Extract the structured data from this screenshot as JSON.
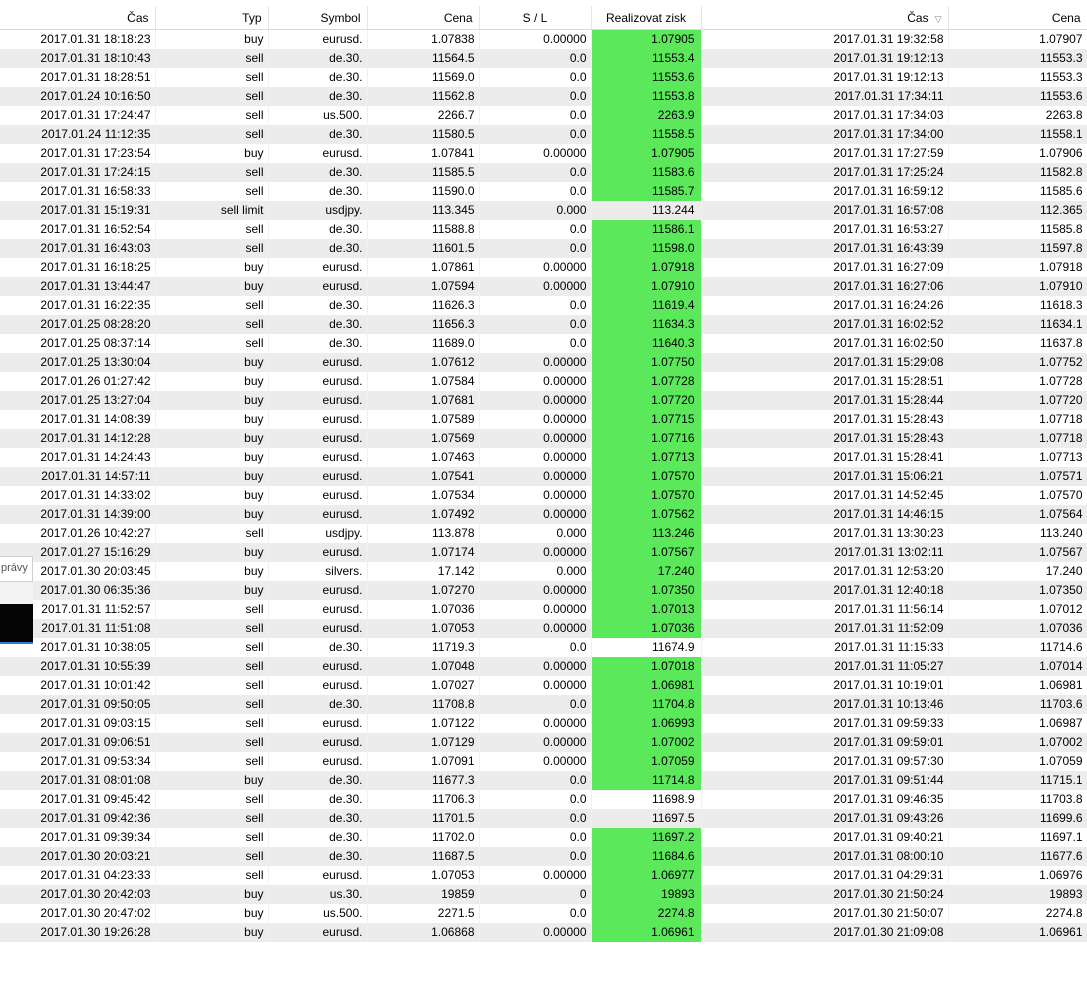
{
  "columns": [
    {
      "key": "open_time",
      "label": "Čas",
      "width": 155
    },
    {
      "key": "type",
      "label": "Typ",
      "width": 113
    },
    {
      "key": "symbol",
      "label": "Symbol",
      "width": 99
    },
    {
      "key": "open_price",
      "label": "Cena",
      "width": 112
    },
    {
      "key": "sl",
      "label": "S / L",
      "width": 112
    },
    {
      "key": "tp",
      "label": "Realizovat zisk",
      "width": 110
    },
    {
      "key": "close_time",
      "label": "Čas",
      "width": 247,
      "sort_indicator": "▽"
    },
    {
      "key": "close_price",
      "label": "Cena",
      "width": 139
    }
  ],
  "colors": {
    "tp_hit": "#5be85b",
    "row_alt": "#ececec",
    "row": "#ffffff"
  },
  "background_window": {
    "label": "právy"
  },
  "rows": [
    {
      "open_time": "2017.01.31 18:18:23",
      "type": "buy",
      "symbol": "eurusd.",
      "open_price": "1.07838",
      "sl": "0.00000",
      "tp": "1.07905",
      "close_time": "2017.01.31 19:32:58",
      "close_price": "1.07907",
      "tp_hit": true
    },
    {
      "open_time": "2017.01.31 18:10:43",
      "type": "sell",
      "symbol": "de.30.",
      "open_price": "11564.5",
      "sl": "0.0",
      "tp": "11553.4",
      "close_time": "2017.01.31 19:12:13",
      "close_price": "11553.3",
      "tp_hit": true
    },
    {
      "open_time": "2017.01.31 18:28:51",
      "type": "sell",
      "symbol": "de.30.",
      "open_price": "11569.0",
      "sl": "0.0",
      "tp": "11553.6",
      "close_time": "2017.01.31 19:12:13",
      "close_price": "11553.3",
      "tp_hit": true
    },
    {
      "open_time": "2017.01.24 10:16:50",
      "type": "sell",
      "symbol": "de.30.",
      "open_price": "11562.8",
      "sl": "0.0",
      "tp": "11553.8",
      "close_time": "2017.01.31 17:34:11",
      "close_price": "11553.6",
      "tp_hit": true
    },
    {
      "open_time": "2017.01.31 17:24:47",
      "type": "sell",
      "symbol": "us.500.",
      "open_price": "2266.7",
      "sl": "0.0",
      "tp": "2263.9",
      "close_time": "2017.01.31 17:34:03",
      "close_price": "2263.8",
      "tp_hit": true
    },
    {
      "open_time": "2017.01.24 11:12:35",
      "type": "sell",
      "symbol": "de.30.",
      "open_price": "11580.5",
      "sl": "0.0",
      "tp": "11558.5",
      "close_time": "2017.01.31 17:34:00",
      "close_price": "11558.1",
      "tp_hit": true
    },
    {
      "open_time": "2017.01.31 17:23:54",
      "type": "buy",
      "symbol": "eurusd.",
      "open_price": "1.07841",
      "sl": "0.00000",
      "tp": "1.07905",
      "close_time": "2017.01.31 17:27:59",
      "close_price": "1.07906",
      "tp_hit": true
    },
    {
      "open_time": "2017.01.31 17:24:15",
      "type": "sell",
      "symbol": "de.30.",
      "open_price": "11585.5",
      "sl": "0.0",
      "tp": "11583.6",
      "close_time": "2017.01.31 17:25:24",
      "close_price": "11582.8",
      "tp_hit": true
    },
    {
      "open_time": "2017.01.31 16:58:33",
      "type": "sell",
      "symbol": "de.30.",
      "open_price": "11590.0",
      "sl": "0.0",
      "tp": "11585.7",
      "close_time": "2017.01.31 16:59:12",
      "close_price": "11585.6",
      "tp_hit": true
    },
    {
      "open_time": "2017.01.31 15:19:31",
      "type": "sell limit",
      "symbol": "usdjpy.",
      "open_price": "113.345",
      "sl": "0.000",
      "tp": "113.244",
      "close_time": "2017.01.31 16:57:08",
      "close_price": "112.365",
      "tp_hit": false
    },
    {
      "open_time": "2017.01.31 16:52:54",
      "type": "sell",
      "symbol": "de.30.",
      "open_price": "11588.8",
      "sl": "0.0",
      "tp": "11586.1",
      "close_time": "2017.01.31 16:53:27",
      "close_price": "11585.8",
      "tp_hit": true
    },
    {
      "open_time": "2017.01.31 16:43:03",
      "type": "sell",
      "symbol": "de.30.",
      "open_price": "11601.5",
      "sl": "0.0",
      "tp": "11598.0",
      "close_time": "2017.01.31 16:43:39",
      "close_price": "11597.8",
      "tp_hit": true
    },
    {
      "open_time": "2017.01.31 16:18:25",
      "type": "buy",
      "symbol": "eurusd.",
      "open_price": "1.07861",
      "sl": "0.00000",
      "tp": "1.07918",
      "close_time": "2017.01.31 16:27:09",
      "close_price": "1.07918",
      "tp_hit": true
    },
    {
      "open_time": "2017.01.31 13:44:47",
      "type": "buy",
      "symbol": "eurusd.",
      "open_price": "1.07594",
      "sl": "0.00000",
      "tp": "1.07910",
      "close_time": "2017.01.31 16:27:06",
      "close_price": "1.07910",
      "tp_hit": true
    },
    {
      "open_time": "2017.01.31 16:22:35",
      "type": "sell",
      "symbol": "de.30.",
      "open_price": "11626.3",
      "sl": "0.0",
      "tp": "11619.4",
      "close_time": "2017.01.31 16:24:26",
      "close_price": "11618.3",
      "tp_hit": true
    },
    {
      "open_time": "2017.01.25 08:28:20",
      "type": "sell",
      "symbol": "de.30.",
      "open_price": "11656.3",
      "sl": "0.0",
      "tp": "11634.3",
      "close_time": "2017.01.31 16:02:52",
      "close_price": "11634.1",
      "tp_hit": true
    },
    {
      "open_time": "2017.01.25 08:37:14",
      "type": "sell",
      "symbol": "de.30.",
      "open_price": "11689.0",
      "sl": "0.0",
      "tp": "11640.3",
      "close_time": "2017.01.31 16:02:50",
      "close_price": "11637.8",
      "tp_hit": true
    },
    {
      "open_time": "2017.01.25 13:30:04",
      "type": "buy",
      "symbol": "eurusd.",
      "open_price": "1.07612",
      "sl": "0.00000",
      "tp": "1.07750",
      "close_time": "2017.01.31 15:29:08",
      "close_price": "1.07752",
      "tp_hit": true
    },
    {
      "open_time": "2017.01.26 01:27:42",
      "type": "buy",
      "symbol": "eurusd.",
      "open_price": "1.07584",
      "sl": "0.00000",
      "tp": "1.07728",
      "close_time": "2017.01.31 15:28:51",
      "close_price": "1.07728",
      "tp_hit": true
    },
    {
      "open_time": "2017.01.25 13:27:04",
      "type": "buy",
      "symbol": "eurusd.",
      "open_price": "1.07681",
      "sl": "0.00000",
      "tp": "1.07720",
      "close_time": "2017.01.31 15:28:44",
      "close_price": "1.07720",
      "tp_hit": true
    },
    {
      "open_time": "2017.01.31 14:08:39",
      "type": "buy",
      "symbol": "eurusd.",
      "open_price": "1.07589",
      "sl": "0.00000",
      "tp": "1.07715",
      "close_time": "2017.01.31 15:28:43",
      "close_price": "1.07718",
      "tp_hit": true
    },
    {
      "open_time": "2017.01.31 14:12:28",
      "type": "buy",
      "symbol": "eurusd.",
      "open_price": "1.07569",
      "sl": "0.00000",
      "tp": "1.07716",
      "close_time": "2017.01.31 15:28:43",
      "close_price": "1.07718",
      "tp_hit": true
    },
    {
      "open_time": "2017.01.31 14:24:43",
      "type": "buy",
      "symbol": "eurusd.",
      "open_price": "1.07463",
      "sl": "0.00000",
      "tp": "1.07713",
      "close_time": "2017.01.31 15:28:41",
      "close_price": "1.07713",
      "tp_hit": true
    },
    {
      "open_time": "2017.01.31 14:57:11",
      "type": "buy",
      "symbol": "eurusd.",
      "open_price": "1.07541",
      "sl": "0.00000",
      "tp": "1.07570",
      "close_time": "2017.01.31 15:06:21",
      "close_price": "1.07571",
      "tp_hit": true
    },
    {
      "open_time": "2017.01.31 14:33:02",
      "type": "buy",
      "symbol": "eurusd.",
      "open_price": "1.07534",
      "sl": "0.00000",
      "tp": "1.07570",
      "close_time": "2017.01.31 14:52:45",
      "close_price": "1.07570",
      "tp_hit": true
    },
    {
      "open_time": "2017.01.31 14:39:00",
      "type": "buy",
      "symbol": "eurusd.",
      "open_price": "1.07492",
      "sl": "0.00000",
      "tp": "1.07562",
      "close_time": "2017.01.31 14:46:15",
      "close_price": "1.07564",
      "tp_hit": true
    },
    {
      "open_time": "2017.01.26 10:42:27",
      "type": "sell",
      "symbol": "usdjpy.",
      "open_price": "113.878",
      "sl": "0.000",
      "tp": "113.246",
      "close_time": "2017.01.31 13:30:23",
      "close_price": "113.240",
      "tp_hit": true
    },
    {
      "open_time": "2017.01.27 15:16:29",
      "type": "buy",
      "symbol": "eurusd.",
      "open_price": "1.07174",
      "sl": "0.00000",
      "tp": "1.07567",
      "close_time": "2017.01.31 13:02:11",
      "close_price": "1.07567",
      "tp_hit": true
    },
    {
      "open_time": "2017.01.30 20:03:45",
      "type": "buy",
      "symbol": "silvers.",
      "open_price": "17.142",
      "sl": "0.000",
      "tp": "17.240",
      "close_time": "2017.01.31 12:53:20",
      "close_price": "17.240",
      "tp_hit": true
    },
    {
      "open_time": "2017.01.30 06:35:36",
      "type": "buy",
      "symbol": "eurusd.",
      "open_price": "1.07270",
      "sl": "0.00000",
      "tp": "1.07350",
      "close_time": "2017.01.31 12:40:18",
      "close_price": "1.07350",
      "tp_hit": true
    },
    {
      "open_time": "2017.01.31 11:52:57",
      "type": "sell",
      "symbol": "eurusd.",
      "open_price": "1.07036",
      "sl": "0.00000",
      "tp": "1.07013",
      "close_time": "2017.01.31 11:56:14",
      "close_price": "1.07012",
      "tp_hit": true
    },
    {
      "open_time": "2017.01.31 11:51:08",
      "type": "sell",
      "symbol": "eurusd.",
      "open_price": "1.07053",
      "sl": "0.00000",
      "tp": "1.07036",
      "close_time": "2017.01.31 11:52:09",
      "close_price": "1.07036",
      "tp_hit": true
    },
    {
      "open_time": "2017.01.31 10:38:05",
      "type": "sell",
      "symbol": "de.30.",
      "open_price": "11719.3",
      "sl": "0.0",
      "tp": "11674.9",
      "close_time": "2017.01.31 11:15:33",
      "close_price": "11714.6",
      "tp_hit": false
    },
    {
      "open_time": "2017.01.31 10:55:39",
      "type": "sell",
      "symbol": "eurusd.",
      "open_price": "1.07048",
      "sl": "0.00000",
      "tp": "1.07018",
      "close_time": "2017.01.31 11:05:27",
      "close_price": "1.07014",
      "tp_hit": true
    },
    {
      "open_time": "2017.01.31 10:01:42",
      "type": "sell",
      "symbol": "eurusd.",
      "open_price": "1.07027",
      "sl": "0.00000",
      "tp": "1.06981",
      "close_time": "2017.01.31 10:19:01",
      "close_price": "1.06981",
      "tp_hit": true
    },
    {
      "open_time": "2017.01.31 09:50:05",
      "type": "sell",
      "symbol": "de.30.",
      "open_price": "11708.8",
      "sl": "0.0",
      "tp": "11704.8",
      "close_time": "2017.01.31 10:13:46",
      "close_price": "11703.6",
      "tp_hit": true
    },
    {
      "open_time": "2017.01.31 09:03:15",
      "type": "sell",
      "symbol": "eurusd.",
      "open_price": "1.07122",
      "sl": "0.00000",
      "tp": "1.06993",
      "close_time": "2017.01.31 09:59:33",
      "close_price": "1.06987",
      "tp_hit": true
    },
    {
      "open_time": "2017.01.31 09:06:51",
      "type": "sell",
      "symbol": "eurusd.",
      "open_price": "1.07129",
      "sl": "0.00000",
      "tp": "1.07002",
      "close_time": "2017.01.31 09:59:01",
      "close_price": "1.07002",
      "tp_hit": true
    },
    {
      "open_time": "2017.01.31 09:53:34",
      "type": "sell",
      "symbol": "eurusd.",
      "open_price": "1.07091",
      "sl": "0.00000",
      "tp": "1.07059",
      "close_time": "2017.01.31 09:57:30",
      "close_price": "1.07059",
      "tp_hit": true
    },
    {
      "open_time": "2017.01.31 08:01:08",
      "type": "buy",
      "symbol": "de.30.",
      "open_price": "11677.3",
      "sl": "0.0",
      "tp": "11714.8",
      "close_time": "2017.01.31 09:51:44",
      "close_price": "11715.1",
      "tp_hit": true
    },
    {
      "open_time": "2017.01.31 09:45:42",
      "type": "sell",
      "symbol": "de.30.",
      "open_price": "11706.3",
      "sl": "0.0",
      "tp": "11698.9",
      "close_time": "2017.01.31 09:46:35",
      "close_price": "11703.8",
      "tp_hit": false
    },
    {
      "open_time": "2017.01.31 09:42:36",
      "type": "sell",
      "symbol": "de.30.",
      "open_price": "11701.5",
      "sl": "0.0",
      "tp": "11697.5",
      "close_time": "2017.01.31 09:43:26",
      "close_price": "11699.6",
      "tp_hit": false
    },
    {
      "open_time": "2017.01.31 09:39:34",
      "type": "sell",
      "symbol": "de.30.",
      "open_price": "11702.0",
      "sl": "0.0",
      "tp": "11697.2",
      "close_time": "2017.01.31 09:40:21",
      "close_price": "11697.1",
      "tp_hit": true
    },
    {
      "open_time": "2017.01.30 20:03:21",
      "type": "sell",
      "symbol": "de.30.",
      "open_price": "11687.5",
      "sl": "0.0",
      "tp": "11684.6",
      "close_time": "2017.01.31 08:00:10",
      "close_price": "11677.6",
      "tp_hit": true
    },
    {
      "open_time": "2017.01.31 04:23:33",
      "type": "sell",
      "symbol": "eurusd.",
      "open_price": "1.07053",
      "sl": "0.00000",
      "tp": "1.06977",
      "close_time": "2017.01.31 04:29:31",
      "close_price": "1.06976",
      "tp_hit": true
    },
    {
      "open_time": "2017.01.30 20:42:03",
      "type": "buy",
      "symbol": "us.30.",
      "open_price": "19859",
      "sl": "0",
      "tp": "19893",
      "close_time": "2017.01.30 21:50:24",
      "close_price": "19893",
      "tp_hit": true
    },
    {
      "open_time": "2017.01.30 20:47:02",
      "type": "buy",
      "symbol": "us.500.",
      "open_price": "2271.5",
      "sl": "0.0",
      "tp": "2274.8",
      "close_time": "2017.01.30 21:50:07",
      "close_price": "2274.8",
      "tp_hit": true
    },
    {
      "open_time": "2017.01.30 19:26:28",
      "type": "buy",
      "symbol": "eurusd.",
      "open_price": "1.06868",
      "sl": "0.00000",
      "tp": "1.06961",
      "close_time": "2017.01.30 21:09:08",
      "close_price": "1.06961",
      "tp_hit": true
    }
  ]
}
